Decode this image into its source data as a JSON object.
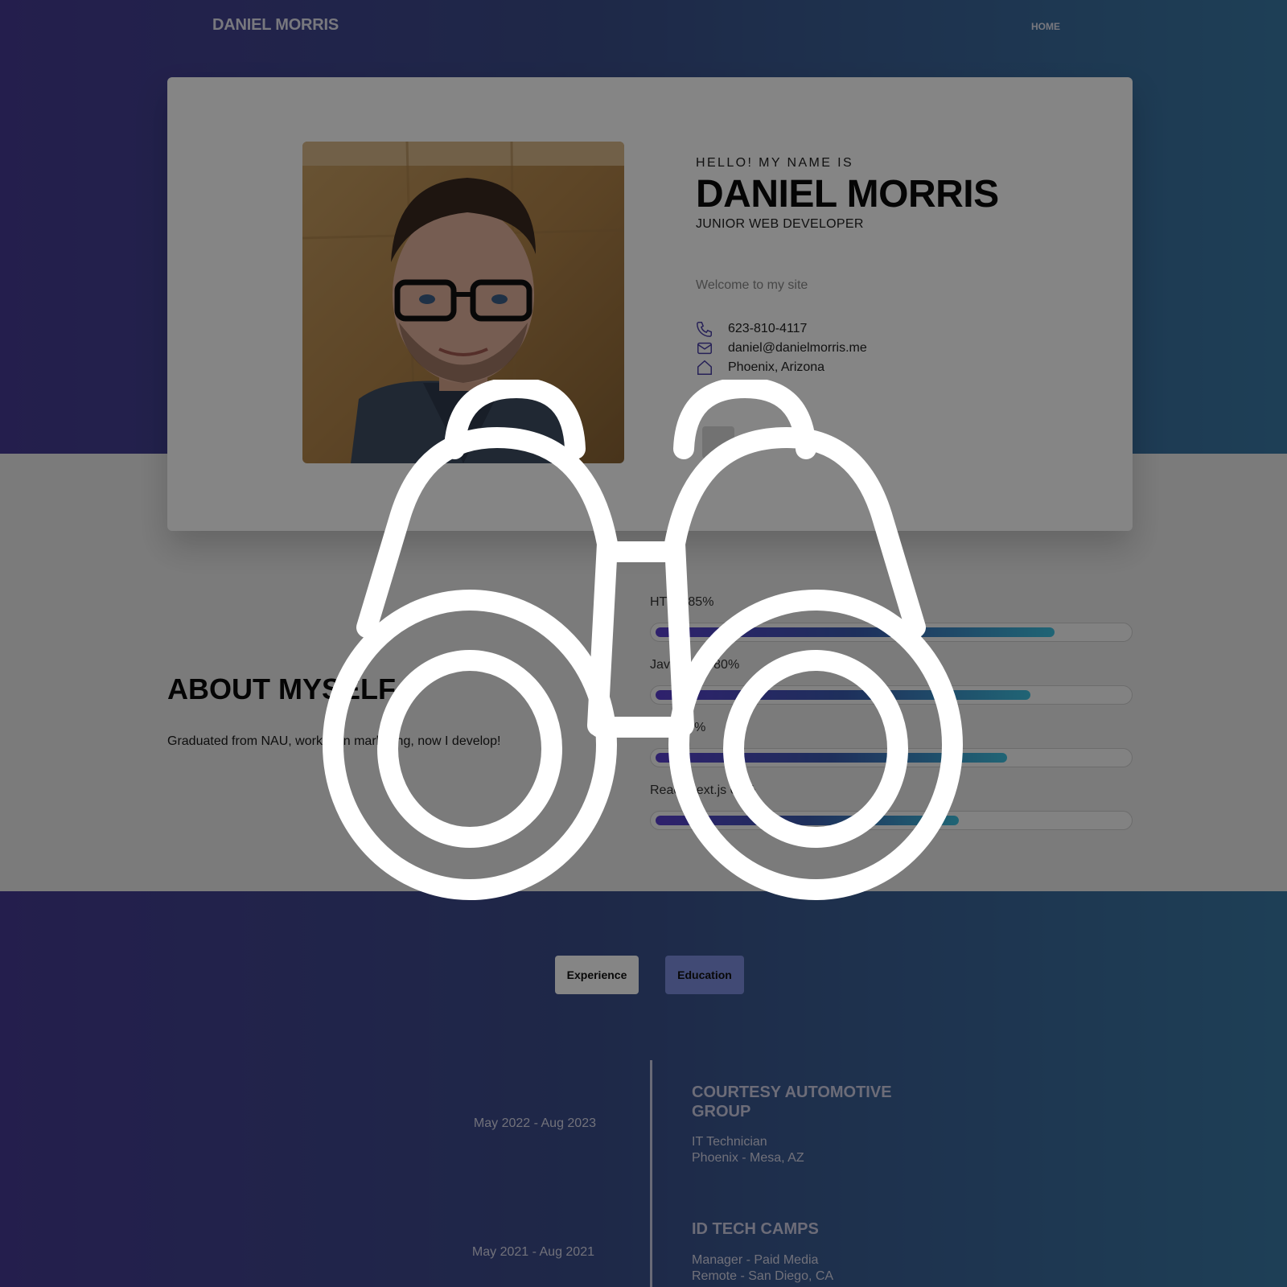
{
  "nav": {
    "logo": "DANIEL MORRIS",
    "home": "HOME"
  },
  "hero": {
    "greeting": "HELLO! MY NAME IS",
    "name": "DANIEL MORRIS",
    "role": "JUNIOR WEB DEVELOPER",
    "welcome": "Welcome to my site",
    "contacts": [
      {
        "icon": "phone-icon",
        "text": "623-810-4117"
      },
      {
        "icon": "mail-icon",
        "text": "daniel@danielmorris.me"
      },
      {
        "icon": "home-icon",
        "text": "Phoenix, Arizona"
      }
    ]
  },
  "about": {
    "title": "ABOUT MYSELF",
    "text": "Graduated from NAU, worked in marketing, now I develop!"
  },
  "skills": [
    {
      "label": "HTML 85%",
      "percent": 85
    },
    {
      "label": "JavaScript 80%",
      "percent": 80
    },
    {
      "label": "CSS 75%",
      "percent": 75
    },
    {
      "label": "React/Next.js 65%",
      "percent": 65
    }
  ],
  "tabs": {
    "experience": "Experience",
    "education": "Education"
  },
  "timeline": [
    {
      "date": "May 2022 - Aug 2023",
      "company": "COURTESY AUTOMOTIVE GROUP",
      "title": "IT Technician",
      "location": "Phoenix - Mesa, AZ"
    },
    {
      "date": "May 2021 - Aug 2021",
      "company": "ID TECH CAMPS",
      "title": "Manager - Paid Media",
      "location": "Remote - San Diego, CA"
    }
  ],
  "overlay": {
    "icon": "binoculars-icon"
  },
  "colors": {
    "accent": "#453b94",
    "accent2": "#3a7aa6",
    "skill_start": "#5a3fd0",
    "skill_end": "#3ec1e0",
    "overlay": "rgba(0,0,0,0.48)"
  }
}
